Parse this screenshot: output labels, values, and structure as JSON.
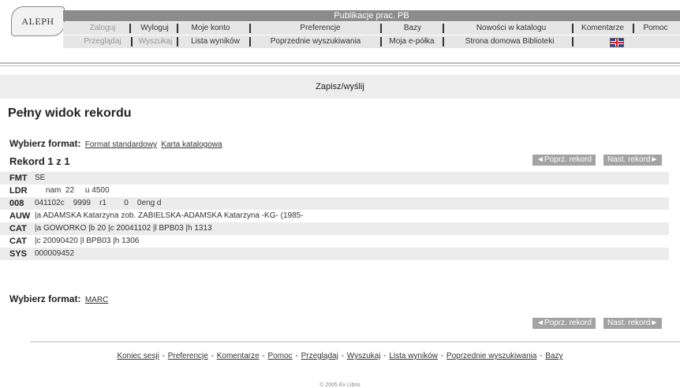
{
  "header": {
    "logo_text": "ALEPH",
    "title": "Publikacje prac. PB",
    "menu_row1": [
      "Zaloguj",
      "Wyloguj",
      "Moje konto",
      "Preferencje",
      "Bazy",
      "Nowości w katalogu",
      "Komentarze",
      "Pomoc"
    ],
    "menu_row2": [
      "Przeglądaj",
      "Wyszukaj",
      "Lista wyników",
      "Poprzednie wyszukiwania",
      "Moja e-półka",
      "Strona domowa Biblioteki"
    ]
  },
  "save_bar": {
    "label": "Zapisz/wyślij"
  },
  "page_title": "Pełny widok rekordu",
  "format_select_top": {
    "label": "Wybierz format:",
    "options": [
      "Format standardowy",
      "Karta katalogowa"
    ]
  },
  "record_count": "Rekord 1 z 1",
  "navigation": {
    "prev": "◄Poprz. rekord",
    "next": "Nast. rekord►"
  },
  "fields": [
    {
      "tag": "FMT",
      "value": "SE"
    },
    {
      "tag": "LDR",
      "value": "     nam  22     u 4500"
    },
    {
      "tag": "008",
      "value": "041102c    9999    r1        0    0eng d"
    },
    {
      "tag": "AUW",
      "value": "|a ADAMSKA Katarzyna zob. ZABIELSKA-ADAMSKA Katarzyna -KG- (1985-"
    },
    {
      "tag": "CAT",
      "value": "|a GOWORKO |b 20 |c 20041102 |l BPB03 |h 1313"
    },
    {
      "tag": "CAT",
      "value": "|c 20090420 |l BPB03 |h 1306"
    },
    {
      "tag": "SYS",
      "value": "000009452"
    }
  ],
  "format_select_bottom": {
    "label": "Wybierz format:",
    "options": [
      "MARC"
    ]
  },
  "footer_links": [
    "Koniec sesji",
    "Preferencje",
    "Komentarze",
    "Pomoc",
    "Przeglądaj",
    "Wyszukaj",
    "Lista wyników",
    "Poprzednie wyszukiwania",
    "Bazy"
  ],
  "copyright": "© 2005 Ex Libris",
  "icons": {
    "language": "uk-flag-icon"
  }
}
